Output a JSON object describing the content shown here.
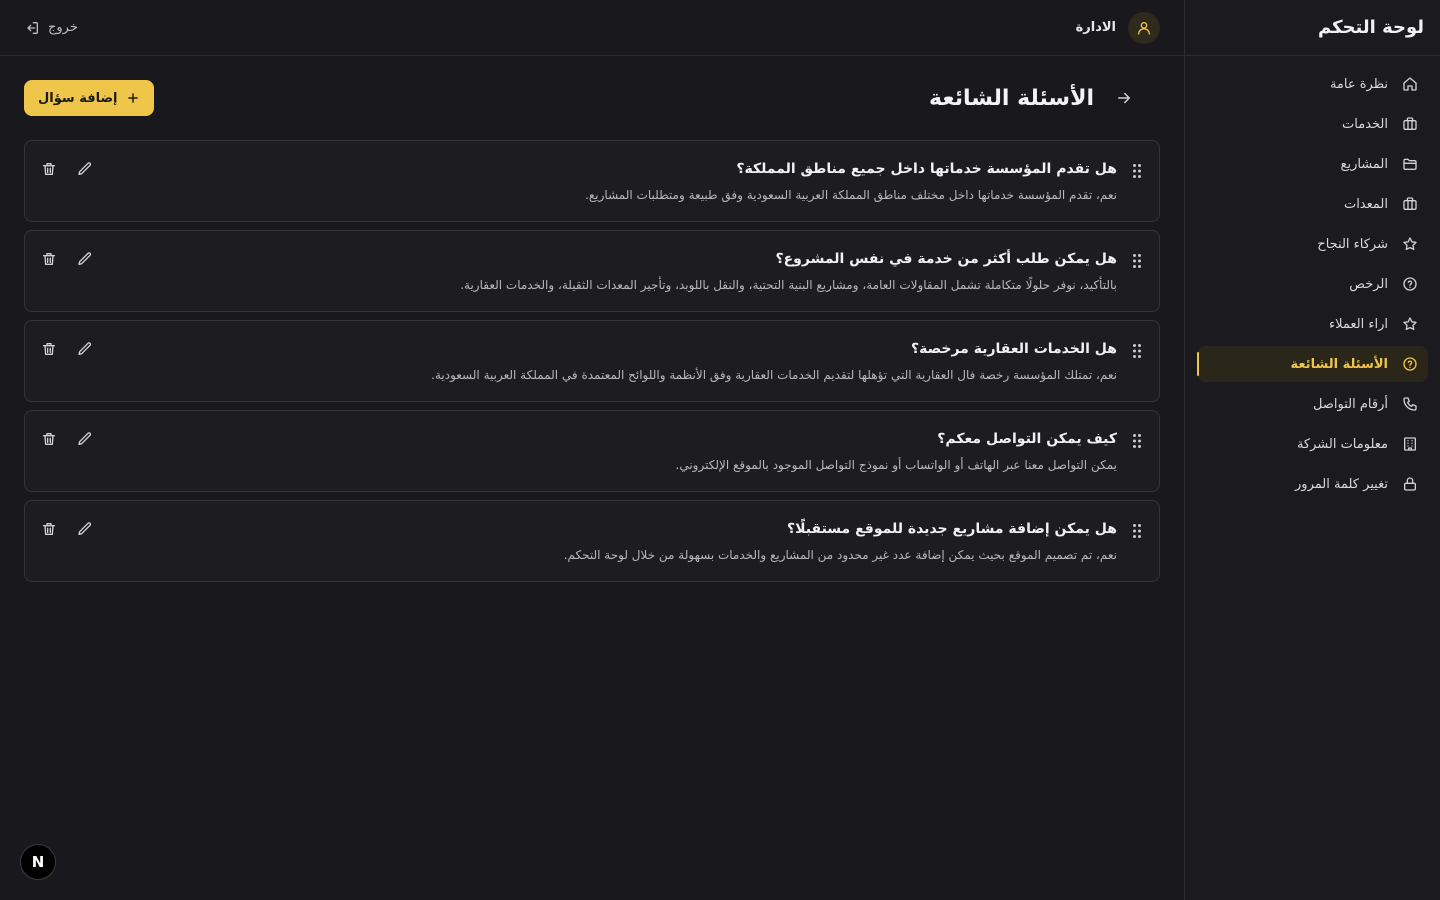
{
  "sidebar": {
    "title": "لوحة التحكم",
    "items": [
      {
        "label": "نظرة عامة",
        "icon": "home-icon",
        "active": false
      },
      {
        "label": "الخدمات",
        "icon": "briefcase-icon",
        "active": false
      },
      {
        "label": "المشاريع",
        "icon": "folder-icon",
        "active": false
      },
      {
        "label": "المعدات",
        "icon": "toolbox-icon",
        "active": false
      },
      {
        "label": "شركاء النجاح",
        "icon": "star-icon",
        "active": false
      },
      {
        "label": "الرخص",
        "icon": "help-circle-icon",
        "active": false
      },
      {
        "label": "اراء العملاء",
        "icon": "star-icon",
        "active": false
      },
      {
        "label": "الأسئلة الشائعة",
        "icon": "help-circle-icon",
        "active": true
      },
      {
        "label": "أرقام التواصل",
        "icon": "phone-icon",
        "active": false
      },
      {
        "label": "معلومات الشركة",
        "icon": "building-icon",
        "active": false
      },
      {
        "label": "تغيير كلمة المرور",
        "icon": "lock-icon",
        "active": false
      }
    ]
  },
  "topbar": {
    "user_name": "الادارة",
    "logout_label": "خروج"
  },
  "page": {
    "title": "الأسئلة الشائعة",
    "add_label": "إضافة سؤال"
  },
  "faqs": [
    {
      "q": "هل تقدم المؤسسة خدماتها داخل جميع مناطق المملكة؟",
      "a": "نعم، تقدم المؤسسة خدماتها داخل مختلف مناطق المملكة العربية السعودية وفق طبيعة ومتطلبات المشاريع."
    },
    {
      "q": "هل يمكن طلب أكثر من خدمة في نفس المشروع؟",
      "a": "بالتأكيد، نوفر حلولًا متكاملة تشمل المقاولات العامة، ومشاريع البنية التحتية، والنقل باللوبد، وتأجير المعدات الثقيلة، والخدمات العقارية."
    },
    {
      "q": "هل الخدمات العقارية مرخصة؟",
      "a": "نعم، تمتلك المؤسسة رخصة فال العقارية التي تؤهلها لتقديم الخدمات العقارية وفق الأنظمة واللوائح المعتمدة في المملكة العربية السعودية."
    },
    {
      "q": "كيف يمكن التواصل معكم؟",
      "a": "يمكن التواصل معنا عبر الهاتف أو الواتساب أو نموذج التواصل الموجود بالموقع الإلكتروني."
    },
    {
      "q": "هل يمكن إضافة مشاريع جديدة للموقع مستقبلًا؟",
      "a": "نعم، تم تصميم الموقع بحيث يمكن إضافة عدد غير محدود من المشاريع والخدمات بسهولة من خلال لوحة التحكم."
    }
  ],
  "badge": {
    "letter": "N"
  },
  "colors": {
    "accent": "#f0c64a",
    "background": "#19191d"
  }
}
